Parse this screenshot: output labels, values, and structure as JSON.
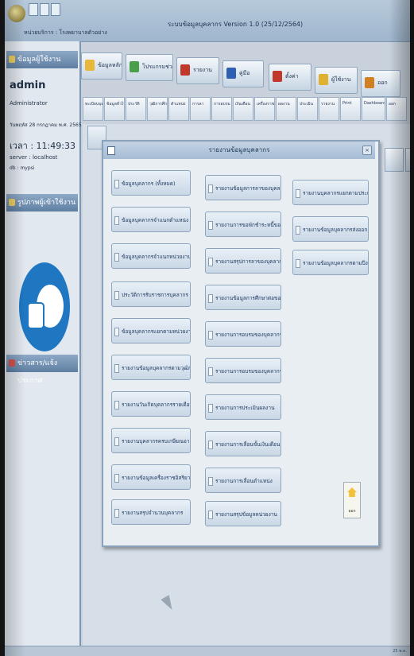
{
  "window": {
    "title": "ระบบข้อมูลบุคลากร Version 1.0 (25/12/2564)",
    "subtitle": "หน่วยบริการ : โรงพยาบาลตัวอย่าง"
  },
  "sidebar": {
    "user_header": "ข้อมูลผู้ใช้งาน",
    "username": "admin",
    "role": "Administrator",
    "date": "วันพฤหัส 28 กรกฎาคม พ.ศ. 2565",
    "time": "เวลา : 11:49:33",
    "server": "server : localhost",
    "db": "db : mypsi",
    "photo_header": "รูปภาพผู้เข้าใช้งาน",
    "news_header": "ข่าวสาร/แจ้งประกาศ"
  },
  "toolbar": {
    "buttons": [
      {
        "label": "ข้อมูลหลัก",
        "icon": "folder-icon",
        "color": "#e8b83a"
      },
      {
        "label": "โปรแกรมช่วยงาน",
        "icon": "tools-icon",
        "color": "#4aa04a"
      },
      {
        "label": "รายงาน",
        "icon": "report-icon",
        "color": "#c0392b"
      },
      {
        "label": "คู่มือ",
        "icon": "book-icon",
        "color": "#2f5fb0"
      },
      {
        "label": "ตั้งค่า",
        "icon": "settings-icon",
        "color": "#c0392b"
      },
      {
        "label": "ผู้ใช้งาน",
        "icon": "user-icon",
        "color": "#e0b030"
      },
      {
        "label": "ออก",
        "icon": "exit-icon",
        "color": "#d08020"
      }
    ]
  },
  "tabs": [
    "ทะเบียนบุคลากร",
    "ข้อมูลทั่วไป",
    "ประวัติ",
    "วุฒิการศึกษา",
    "ตำแหน่ง",
    "การลา",
    "การอบรม",
    "เงินเดือน",
    "เครื่องราชฯ",
    "ผลงาน",
    "ประเมิน",
    "รายงาน",
    "Print",
    "Dashboard",
    "ออก"
  ],
  "dialog": {
    "title": "รายงานข้อมูลบุคลากร",
    "exit_label": "ออก",
    "column1": [
      "ข้อมูลบุคลากร (ทั้งหมด)",
      "ข้อมูลบุคลากรจำแนกตำแหน่ง",
      "ข้อมูลบุคลากรจำแนกหน่วยงาน",
      "ประวัติการรับราชการบุคลากร",
      "ข้อมูลบุคลากรแยกตามหน่วยงาน",
      "รายงานข้อมูลบุคลากรตามวุฒิการศึกษา",
      "รายงานวันเกิดบุคลากรรายเดือน",
      "รายงานบุคลากรครบเกษียณอายุ",
      "รายงานข้อมูลเครื่องราชอิสริยาภรณ์",
      "รายงานสรุปจำนวนบุคลากร"
    ],
    "column2": [
      "รายงานข้อมูลการลาของบุคลากร",
      "รายงานการขอพักชำระหนี้ของบุคลากร",
      "รายงานสรุปการลาของบุคลากร",
      "รายงานข้อมูลการศึกษาต่อของบุคลากร",
      "รายงานการอบรมของบุคลากร",
      "รายงานการอบรมของบุคลากร (2)",
      "รายงานการประเมินผลงาน",
      "รายงานการเลื่อนขั้นเงินเดือน",
      "รายงานการเลื่อนตำแหน่ง",
      "รายงานสรุปข้อมูลหน่วยงาน"
    ],
    "column3": [
      "รายงานบุคลากรแยกตามประเภท",
      "รายงานข้อมูลบุคลากรส่งออก GFMIS",
      "รายงานข้อมูลบุคลากรตามปีงบประมาณ"
    ]
  },
  "statusbar": {
    "text": "25 พ.ค."
  }
}
